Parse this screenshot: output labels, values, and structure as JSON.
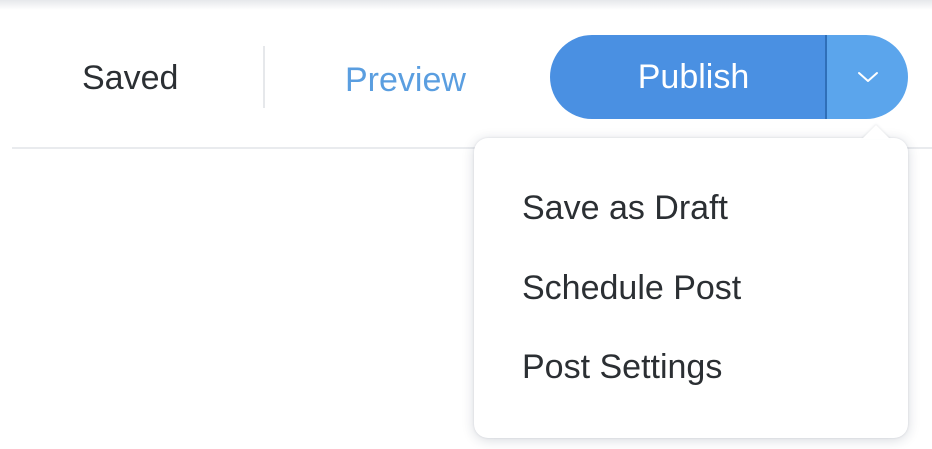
{
  "header": {
    "status_text": "Saved",
    "preview_label": "Preview",
    "publish_label": "Publish",
    "dropdown_icon": "chevron-down-icon"
  },
  "publish_menu": {
    "items": [
      {
        "label": "Save as Draft"
      },
      {
        "label": "Schedule Post"
      },
      {
        "label": "Post Settings"
      }
    ]
  },
  "colors": {
    "publish_blue": "#4a90e2",
    "dropdown_blue": "#5ba5ec",
    "link_blue": "#5a9ee0",
    "text_dark": "#2b2f33"
  }
}
